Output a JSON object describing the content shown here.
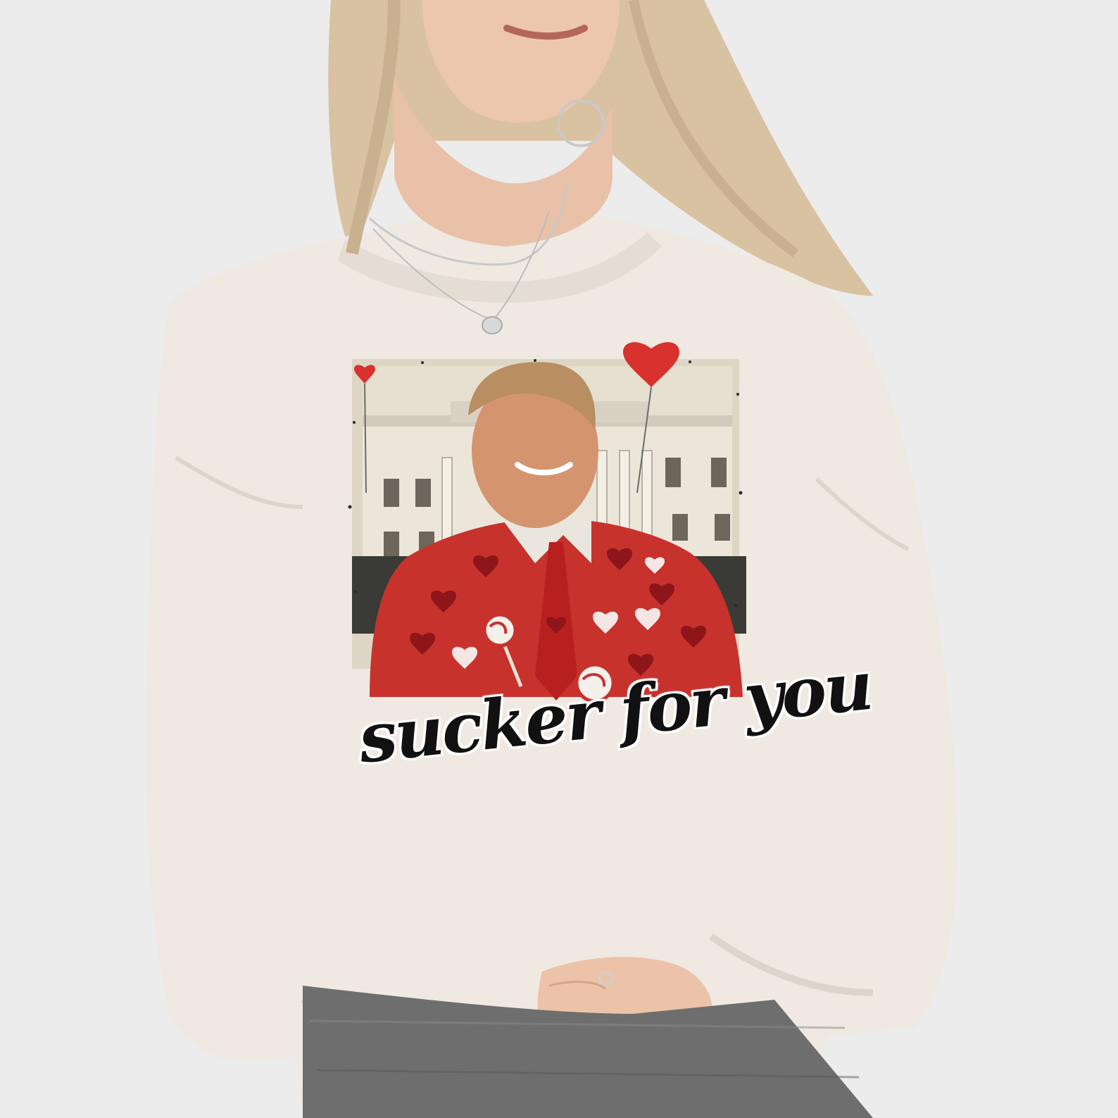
{
  "print": {
    "slogan": "sucker for you"
  },
  "colors": {
    "background": "#ececec",
    "sweatshirt": "#efe9e2",
    "hair": "#d9c2a1",
    "skin": "#e9c1a8",
    "suit_red": "#c8322d",
    "heart_red": "#a81e22",
    "building": "#ece6da",
    "pants": "#6e6e6e"
  },
  "icons": [
    "heart-balloon-icon",
    "lollipop-icon",
    "necklace-icon"
  ]
}
